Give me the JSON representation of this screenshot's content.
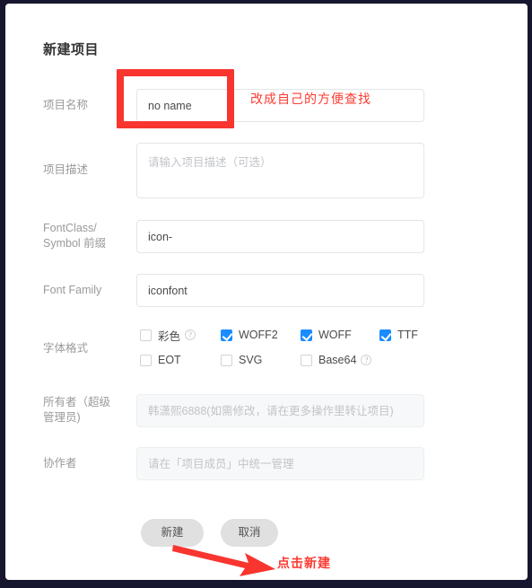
{
  "window": {
    "frame_color": "#16162e",
    "card_background": "#ffffff"
  },
  "panel": {
    "title": "新建项目"
  },
  "form": {
    "rows": [
      {
        "key": "project_name",
        "label": "项目名称",
        "value": "no name",
        "placeholder": "",
        "type": "text",
        "disabled": false
      },
      {
        "key": "project_description",
        "label": "项目描述",
        "value": "",
        "placeholder": "请输入项目描述（可选）",
        "type": "textarea",
        "disabled": false
      },
      {
        "key": "fontclass_prefix",
        "label": "FontClass/\nSymbol 前缀",
        "label_line1": "FontClass/",
        "label_line2": "Symbol 前缀",
        "value": "icon-",
        "placeholder": "",
        "type": "text",
        "disabled": false
      },
      {
        "key": "font_family",
        "label": "Font Family",
        "value": "iconfont",
        "placeholder": "",
        "type": "text",
        "disabled": false
      },
      {
        "key": "owner",
        "label_line1": "所有者（超级",
        "label_line2": "管理员)",
        "value": "",
        "placeholder": "韩潇熙6888(如需修改，请在更多操作里转让项目)",
        "type": "text",
        "disabled": true
      },
      {
        "key": "collaborators",
        "label": "协作者",
        "value": "",
        "placeholder": "请在「项目成员」中统一管理",
        "type": "text",
        "disabled": true
      }
    ],
    "font_format": {
      "label": "字体格式",
      "accent_checked_color": "#1a8cff",
      "options": [
        {
          "label": "彩色",
          "checked": false,
          "help": true,
          "glyph": "?"
        },
        {
          "label": "WOFF2",
          "checked": true,
          "help": false,
          "glyph": ""
        },
        {
          "label": "WOFF",
          "checked": true,
          "help": false,
          "glyph": ""
        },
        {
          "label": "TTF",
          "checked": true,
          "help": false,
          "glyph": ""
        },
        {
          "label": "EOT",
          "checked": false,
          "help": false,
          "glyph": ""
        },
        {
          "label": "SVG",
          "checked": false,
          "help": false,
          "glyph": ""
        },
        {
          "label": "Base64",
          "checked": false,
          "help": true,
          "glyph": "?"
        }
      ]
    }
  },
  "actions": {
    "create_label": "新建",
    "cancel_label": "取消"
  },
  "annotations": {
    "color": "#fc3b32",
    "name_hint": "改成自己的方便查找",
    "create_hint": "点击新建",
    "highlight_box_name": "red-rectangle-highlight",
    "arrow_name": "red-arrow-pointing-to-create-button"
  }
}
